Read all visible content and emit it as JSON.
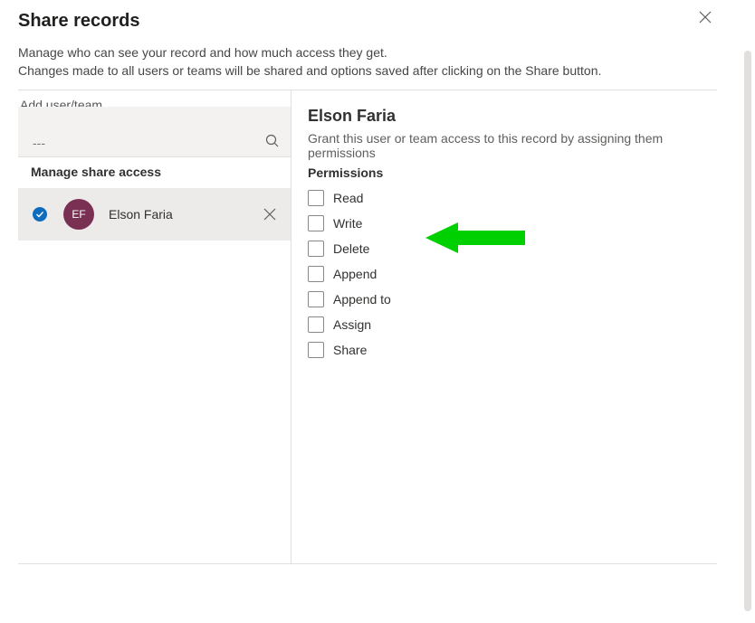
{
  "dialog": {
    "title": "Share records",
    "description_line1": "Manage who can see your record and how much access they get.",
    "description_line2": "Changes made to all users or teams will be shared and options saved after clicking on the Share button."
  },
  "left": {
    "add_label": "Add user/team",
    "search_placeholder": "---",
    "manage_label": "Manage share access",
    "selected_user": {
      "initials": "EF",
      "name": "Elson Faria"
    }
  },
  "right": {
    "title": "Elson Faria",
    "description": "Grant this user or team access to this record by assigning them permissions",
    "permissions_label": "Permissions",
    "permissions": [
      {
        "label": "Read",
        "checked": false
      },
      {
        "label": "Write",
        "checked": false
      },
      {
        "label": "Delete",
        "checked": false
      },
      {
        "label": "Append",
        "checked": false
      },
      {
        "label": "Append to",
        "checked": false
      },
      {
        "label": "Assign",
        "checked": false
      },
      {
        "label": "Share",
        "checked": false
      }
    ]
  },
  "colors": {
    "accent": "#0f6cbd",
    "avatar_bg": "#793053",
    "annotation_arrow": "#00d000"
  }
}
